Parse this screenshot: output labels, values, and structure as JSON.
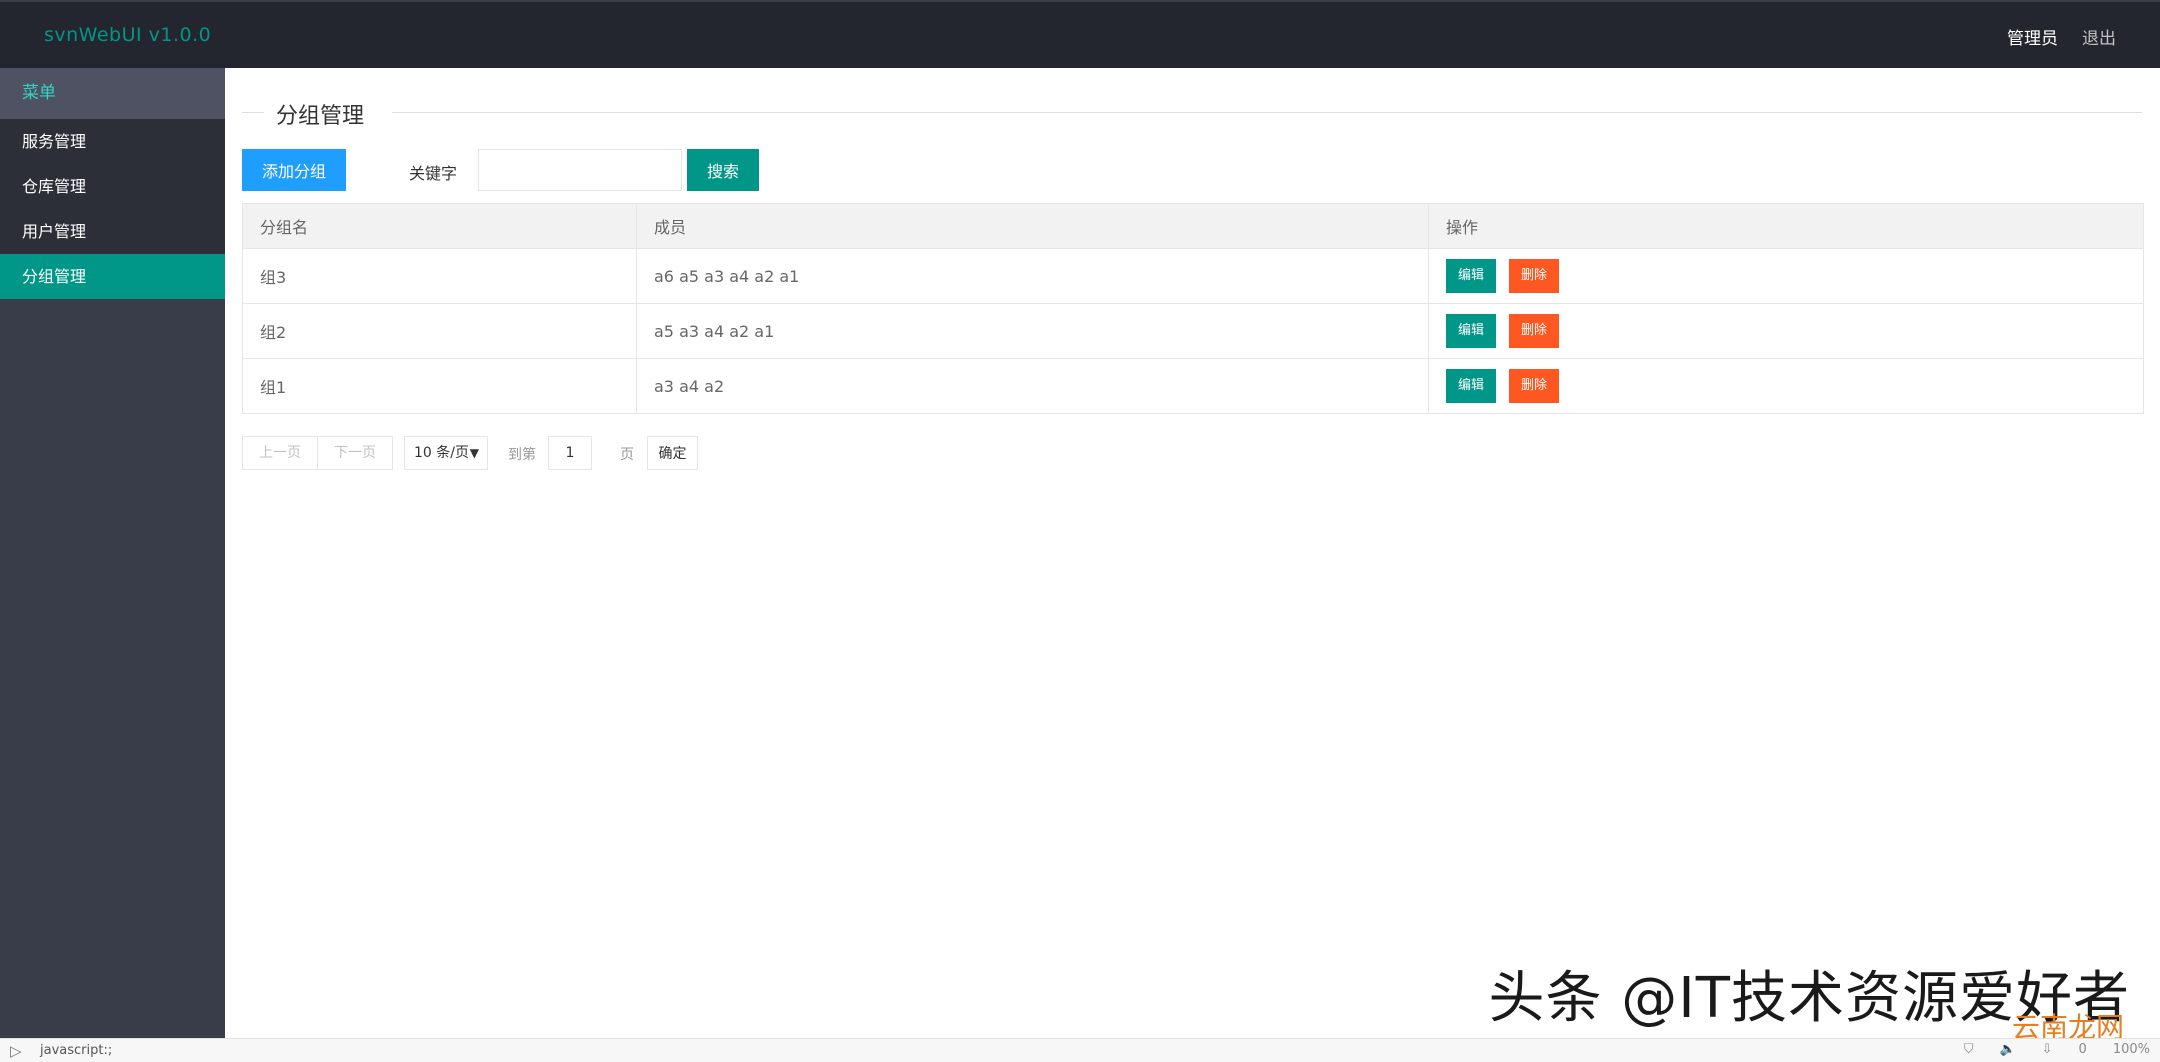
{
  "header": {
    "app_title": "svnWebUI v1.0.0",
    "admin_label": "管理员",
    "logout_label": "退出"
  },
  "sidebar": {
    "menu_title": "菜单",
    "items": [
      {
        "label": "服务管理"
      },
      {
        "label": "仓库管理"
      },
      {
        "label": "用户管理"
      },
      {
        "label": "分组管理",
        "active": true
      }
    ]
  },
  "page": {
    "title": "分组管理",
    "add_button": "添加分组",
    "keyword_label": "关键字",
    "keyword_value": "",
    "search_button": "搜索"
  },
  "table": {
    "columns": [
      "分组名",
      "成员",
      "操作"
    ],
    "rows": [
      {
        "name": "组3",
        "members": "a6 a5 a3 a4 a2 a1"
      },
      {
        "name": "组2",
        "members": "a5 a3 a4 a2 a1"
      },
      {
        "name": "组1",
        "members": "a3 a4 a2"
      }
    ],
    "edit_label": "编辑",
    "delete_label": "删除"
  },
  "pager": {
    "prev_label": "上一页",
    "next_label": "下一页",
    "page_size": "10 条/页",
    "goto_label": "到第",
    "page_value": "1",
    "page_unit": "页",
    "confirm_label": "确定"
  },
  "watermark": {
    "text": "头条 @IT技术资源爱好者",
    "sub": "云南龙网"
  },
  "statusbar": {
    "url": "javascript:;",
    "right_count": "0",
    "zoom": "100%"
  },
  "colors": {
    "header_bg": "#23262e",
    "sidebar_bg": "#393d49",
    "accent": "#009688",
    "primary": "#1e9fff",
    "danger": "#ff5722"
  }
}
